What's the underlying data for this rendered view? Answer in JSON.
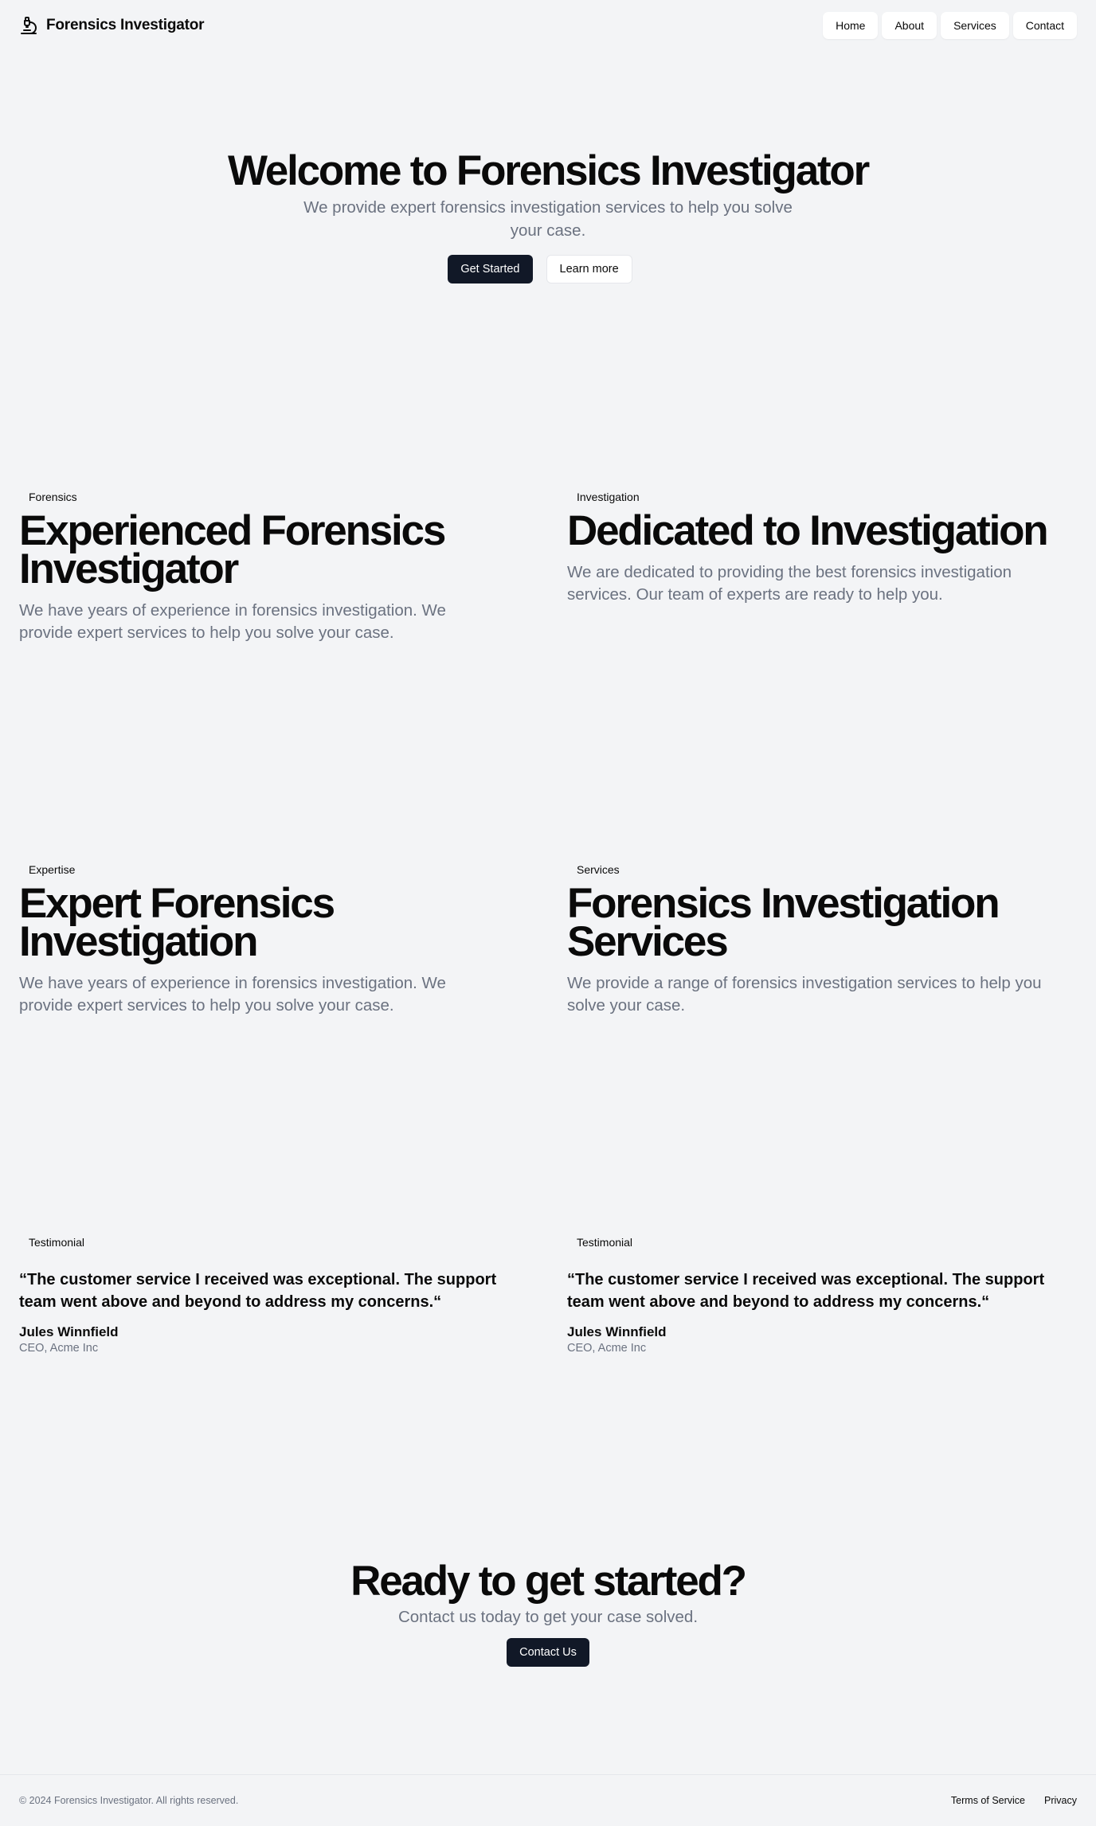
{
  "header": {
    "brand_name": "Forensics Investigator",
    "brand_icon": "microscope-icon",
    "nav": [
      "Home",
      "About",
      "Services",
      "Contact"
    ]
  },
  "hero": {
    "title": "Welcome to Forensics Investigator",
    "subtitle": "We provide expert forensics investigation services to help you solve your case.",
    "primary_label": "Get Started",
    "secondary_label": "Learn more"
  },
  "features": [
    {
      "badge": "Forensics",
      "title": "Experienced Forensics Investigator",
      "text": "We have years of experience in forensics investigation. We provide expert services to help you solve your case."
    },
    {
      "badge": "Investigation",
      "title": "Dedicated to Investigation",
      "text": "We are dedicated to providing the best forensics investigation services. Our team of experts are ready to help you."
    },
    {
      "badge": "Expertise",
      "title": "Expert Forensics Investigation",
      "text": "We have years of experience in forensics investigation. We provide expert services to help you solve your case."
    },
    {
      "badge": "Services",
      "title": "Forensics Investigation Services",
      "text": "We provide a range of forensics investigation services to help you solve your case."
    }
  ],
  "testimonials": [
    {
      "badge": "Testimonial",
      "quote": "“The customer service I received was exceptional. The support team went above and beyond to address my concerns.“",
      "author": "Jules Winnfield",
      "role": "CEO, Acme Inc"
    },
    {
      "badge": "Testimonial",
      "quote": "“The customer service I received was exceptional. The support team went above and beyond to address my concerns.“",
      "author": "Jules Winnfield",
      "role": "CEO, Acme Inc"
    }
  ],
  "cta": {
    "title": "Ready to get started?",
    "subtitle": "Contact us today to get your case solved.",
    "button_label": "Contact Us"
  },
  "footer": {
    "copyright": "© 2024 Forensics Investigator. All rights reserved.",
    "links": [
      "Terms of Service",
      "Privacy"
    ]
  },
  "colors": {
    "background": "#f3f4f6",
    "primary_button": "#111827",
    "muted_text": "#6b7280"
  }
}
